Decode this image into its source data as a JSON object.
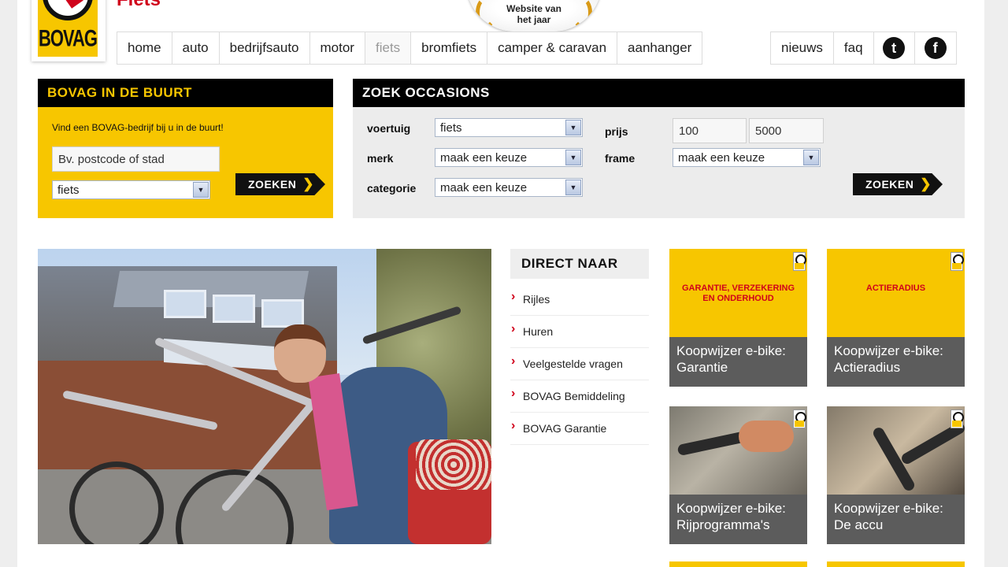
{
  "header": {
    "logo_text": "BOVAG",
    "section_title": "Fiets",
    "award_line1": "Website van",
    "award_line2": "het jaar"
  },
  "nav": {
    "main": [
      "home",
      "auto",
      "bedrijfsauto",
      "motor",
      "fiets",
      "bromfiets",
      "camper & caravan",
      "aanhanger"
    ],
    "active": "fiets",
    "right": [
      "nieuws",
      "faq"
    ],
    "social": [
      {
        "name": "twitter-icon",
        "glyph": "t"
      },
      {
        "name": "facebook-icon",
        "glyph": "f"
      }
    ]
  },
  "buurt": {
    "title": "BOVAG IN DE BUURT",
    "intro": "Vind een BOVAG-bedrijf bij u in de buurt!",
    "location_placeholder": "Bv. postcode of stad",
    "category_value": "fiets",
    "button": "ZOEKEN"
  },
  "occasions": {
    "title": "ZOEK OCCASIONS",
    "voertuig_label": "voertuig",
    "voertuig_value": "fiets",
    "merk_label": "merk",
    "merk_value": "maak een keuze",
    "categorie_label": "categorie",
    "categorie_value": "maak een keuze",
    "prijs_label": "prijs",
    "prijs_min": "100",
    "prijs_max": "5000",
    "frame_label": "frame",
    "frame_value": "maak een keuze",
    "button": "ZOEKEN"
  },
  "direct_naar": {
    "title": "DIRECT NAAR",
    "items": [
      "Rijles",
      "Huren",
      "Veelgestelde vragen",
      "BOVAG Bemiddeling",
      "BOVAG Garantie"
    ]
  },
  "tiles": [
    {
      "tag": "GARANTIE, VERZEKERING EN ONDERHOUD",
      "caption_line1": "Koopwijzer e-bike:",
      "caption_line2": "Garantie"
    },
    {
      "tag": "ACTIERADIUS",
      "caption_line1": "Koopwijzer e-bike:",
      "caption_line2": "Actieradius"
    },
    {
      "tag": "",
      "caption_line1": "Koopwijzer e-bike:",
      "caption_line2": "Rijprogramma's"
    },
    {
      "tag": "",
      "caption_line1": "Koopwijzer e-bike:",
      "caption_line2": "De accu"
    }
  ],
  "colors": {
    "brand_yellow": "#f7c600",
    "brand_red": "#d0021b",
    "black": "#000000",
    "caption_grey": "#5c5c5c"
  }
}
